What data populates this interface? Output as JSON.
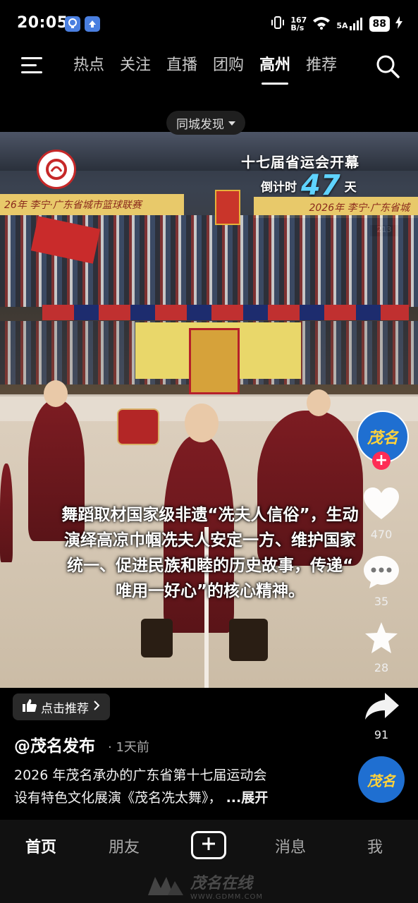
{
  "status_bar": {
    "time": "20:05",
    "net_speed_top": "167",
    "net_speed_bottom": "B/s",
    "signal_label": "5A",
    "battery": "88"
  },
  "top_nav": {
    "tabs": [
      {
        "label": "热点",
        "active": false
      },
      {
        "label": "关注",
        "active": false
      },
      {
        "label": "直播",
        "active": false
      },
      {
        "label": "团购",
        "active": false
      },
      {
        "label": "高州",
        "active": true
      },
      {
        "label": "推荐",
        "active": false
      }
    ]
  },
  "discover_pill": {
    "label": "同城发现"
  },
  "video": {
    "overlay_title": "十七届省运会开幕",
    "countdown_prefix": "倒计时",
    "countdown_number": "47",
    "countdown_suffix": "天",
    "banner_left": "26年 李宁·广东省城市篮球联赛",
    "banner_right": "2026年 李宁·广东省城",
    "scoreboard": "213",
    "caption_lines": [
      "舞蹈取材国家级非遗“冼夫人信俗”，生动",
      "演绎高凉巾帼冼夫人安定一方、维护国家",
      "统一、促进民族和睦的历史故事，传递“",
      "唯用一好心”的核心精神。"
    ]
  },
  "actions": {
    "author_avatar_text": "茂名",
    "like_count": "470",
    "comment_count": "35",
    "favorite_count": "28",
    "share_count": "91"
  },
  "info": {
    "recommend_label": "点击推荐",
    "author": "@茂名发布",
    "time": "1天前",
    "desc_line1": "2026 年茂名承办的广东省第十七届运动会",
    "desc_line2": "设有特色文化展演《茂名冼太舞》，",
    "expand_label": "...展开",
    "music_avatar_text": "茂名"
  },
  "bottom_tabs": {
    "home": "首页",
    "friends": "朋友",
    "messages": "消息",
    "me": "我"
  },
  "watermark": {
    "text": "茂名在线",
    "url": "WWW.GDMM.COM"
  },
  "colors": {
    "accent_red": "#fe2c55",
    "countdown_blue": "#5fd3ff"
  }
}
